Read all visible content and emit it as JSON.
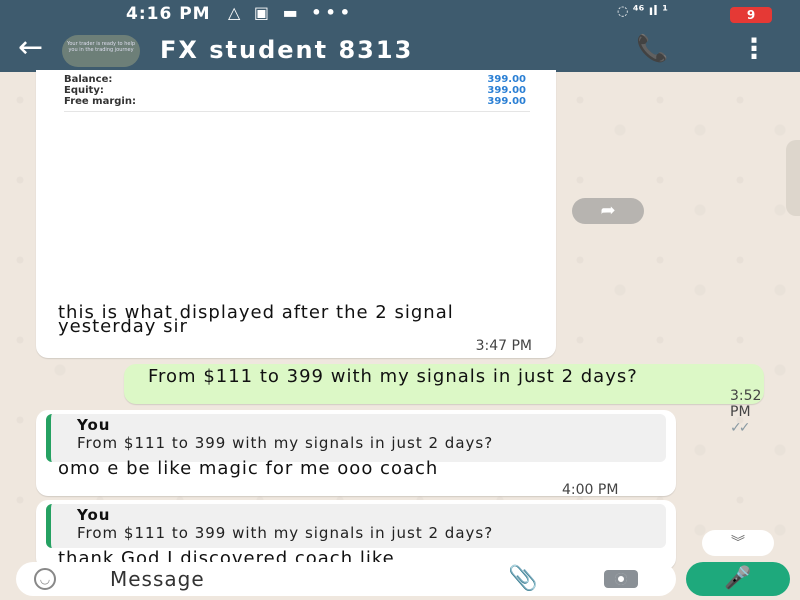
{
  "status_bar": {
    "time": "4:16 PM",
    "left_icons": "△ ▣ ▬ •••",
    "right_icons": "◌ ⁴⁶ ıl ¹",
    "battery": "9"
  },
  "header": {
    "contact_name": "FX student 8313",
    "avatar_caption": "Your trader is ready to help you in the trading journey"
  },
  "messages": {
    "image_message": {
      "account": [
        {
          "label": "Balance:",
          "value": "399.00"
        },
        {
          "label": "Equity:",
          "value": "399.00"
        },
        {
          "label": "Free margin:",
          "value": "399.00"
        }
      ],
      "caption": "this is what displayed after the 2 signal yesterday sir",
      "time": "3:47 PM"
    },
    "outgoing": {
      "text": "From $111 to 399 with my signals in just 2 days?",
      "time": "3:52 PM",
      "ticks": "✓✓"
    },
    "reply1": {
      "quote_author": "You",
      "quote_text": "From $111 to 399 with my signals in just 2 days?",
      "text": "omo e be like magic for me ooo coach",
      "time": "4:00 PM"
    },
    "reply2": {
      "quote_author": "You",
      "quote_text": "From $111 to 399 with my signals in just 2 days?",
      "text": "thank God I discovered coach like"
    }
  },
  "input": {
    "placeholder": "Message"
  },
  "icons": {
    "back": "back-arrow-icon",
    "call": "add-call-icon",
    "menu": "more-vert-icon",
    "forward": "forward-icon",
    "scroll_down": "double-chevron-down-icon",
    "emoji": "emoji-icon",
    "attach": "paperclip-icon",
    "camera": "camera-icon",
    "mic": "microphone-icon"
  },
  "colors": {
    "header": "#3e5b6e",
    "outgoing_bubble": "#dcf8c6",
    "incoming_bubble": "#ffffff",
    "accent_green": "#1ea97c",
    "quote_bar": "#25a162",
    "amount_blue": "#2a7fd4"
  }
}
